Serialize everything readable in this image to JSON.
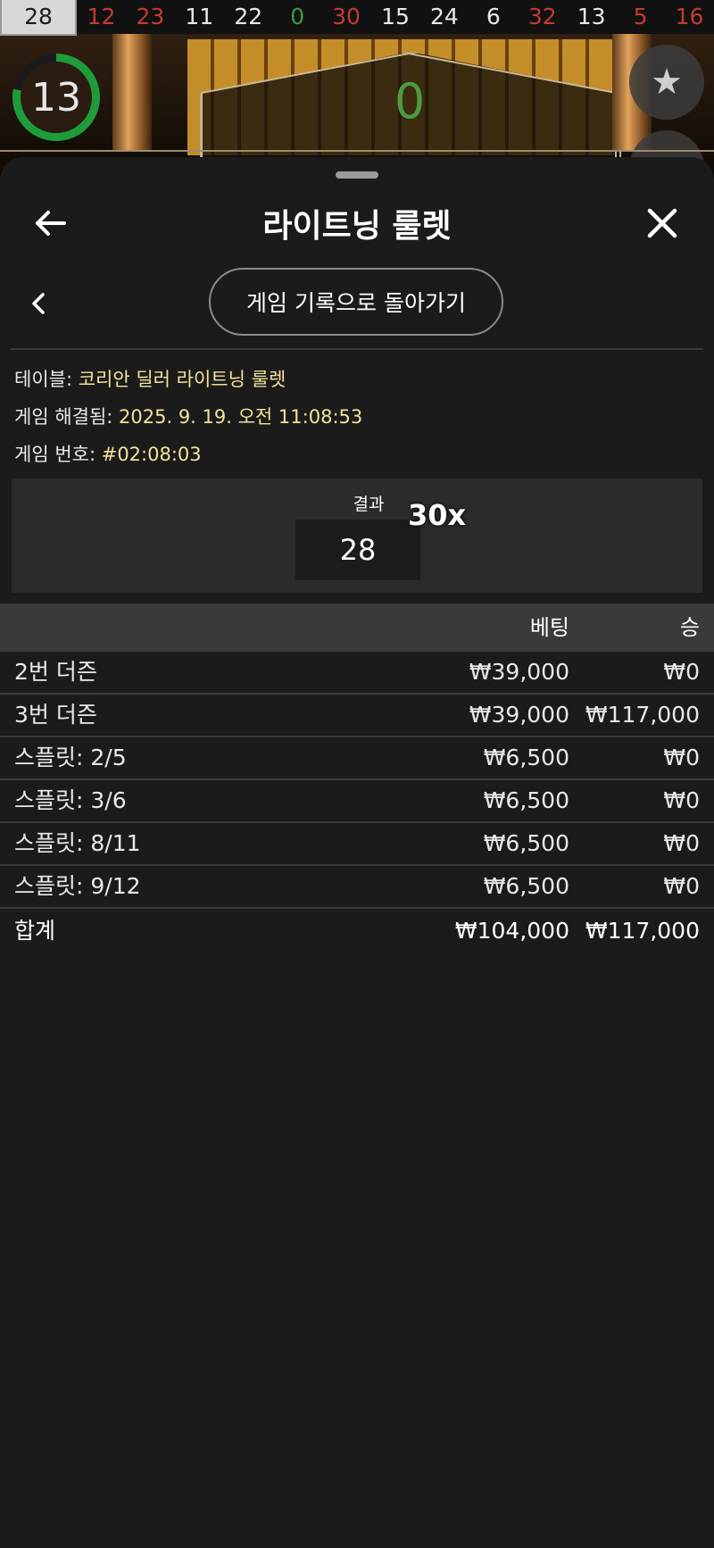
{
  "game": {
    "history": [
      {
        "n": "28",
        "color": "current"
      },
      {
        "n": "12",
        "color": "red"
      },
      {
        "n": "23",
        "color": "red"
      },
      {
        "n": "11",
        "color": "black"
      },
      {
        "n": "22",
        "color": "black"
      },
      {
        "n": "0",
        "color": "green"
      },
      {
        "n": "30",
        "color": "red"
      },
      {
        "n": "15",
        "color": "black"
      },
      {
        "n": "24",
        "color": "black"
      },
      {
        "n": "6",
        "color": "black"
      },
      {
        "n": "32",
        "color": "red"
      },
      {
        "n": "13",
        "color": "black"
      },
      {
        "n": "5",
        "color": "red"
      },
      {
        "n": "16",
        "color": "red"
      }
    ],
    "timer": "13",
    "board_value": "0"
  },
  "sheet": {
    "title": "라이트닝 룰렛",
    "history_button": "게임 기록으로 돌아가기",
    "meta": [
      {
        "label": "테이블: ",
        "value": "코리안 딜러 라이트닝 룰렛"
      },
      {
        "label": "게임 해결됨: ",
        "value": "2025. 9. 19. 오전 11:08:53"
      },
      {
        "label": "게임 번호: ",
        "value": "#02:08:03"
      }
    ],
    "result": {
      "label": "결과",
      "number": "28",
      "multiplier": "30x"
    },
    "table": {
      "headers": {
        "bet": "베팅",
        "win": "승"
      },
      "rows": [
        {
          "name": "2번 더즌",
          "bet": "₩39,000",
          "win": "₩0"
        },
        {
          "name": "3번 더즌",
          "bet": "₩39,000",
          "win": "₩117,000"
        },
        {
          "name": "스플릿: 2/5",
          "bet": "₩6,500",
          "win": "₩0"
        },
        {
          "name": "스플릿: 3/6",
          "bet": "₩6,500",
          "win": "₩0"
        },
        {
          "name": "스플릿: 8/11",
          "bet": "₩6,500",
          "win": "₩0"
        },
        {
          "name": "스플릿: 9/12",
          "bet": "₩6,500",
          "win": "₩0"
        }
      ],
      "total": {
        "name": "합계",
        "bet": "₩104,000",
        "win": "₩117,000"
      }
    }
  }
}
